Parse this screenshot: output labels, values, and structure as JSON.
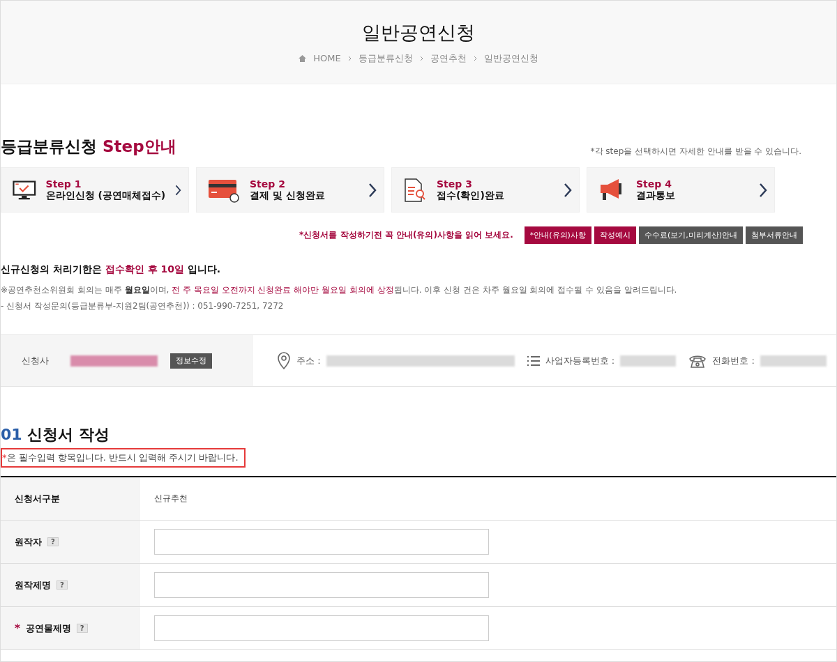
{
  "header": {
    "title": "일반공연신청",
    "breadcrumb": [
      "HOME",
      "등급분류신청",
      "공연추천",
      "일반공연신청"
    ]
  },
  "guide": {
    "title": "등급분류신청",
    "title_accent": "Step안내",
    "hint": "*각 step을 선택하시면 자세한 안내를 받을 수 있습니다."
  },
  "steps": [
    {
      "kind": "monitor",
      "step": "Step 1",
      "label": "온라인신청 (공연매체접수)"
    },
    {
      "kind": "card",
      "step": "Step 2",
      "label": "결제 및 신청완료"
    },
    {
      "kind": "document",
      "step": "Step 3",
      "label": "접수(확인)완료"
    },
    {
      "kind": "megaphone",
      "step": "Step 4",
      "label": "결과통보"
    }
  ],
  "notice_bar": {
    "text": "*신청서를 작성하기전 꼭 안내(유의)사항을 읽어 보세요.",
    "buttons": [
      {
        "label": "*안내(유의)사항",
        "kind": "primary"
      },
      {
        "label": "작성예시",
        "kind": "primary"
      },
      {
        "label": "수수료(보기,미리계산)안내",
        "kind": "dark"
      },
      {
        "label": "첨부서류안내",
        "kind": "dark"
      }
    ]
  },
  "deadline": [
    {
      "text": "신규신청의 처리기한은 ",
      "kind": "plain"
    },
    {
      "text": "접수확인 후 10일",
      "kind": "accent"
    },
    {
      "text": " 입니다.",
      "kind": "plain"
    }
  ],
  "info_lines": [
    [
      {
        "text": "※공연추천소위원회 회의는 매주 ",
        "kind": "plain"
      },
      {
        "text": "월요일",
        "kind": "bold"
      },
      {
        "text": "이며, ",
        "kind": "plain"
      },
      {
        "text": "전 주 목요일 오전까지 신청완료 해야만 월요일 회의에 상정",
        "kind": "accent"
      },
      {
        "text": "됩니다. 이후 신청 건은 차주 월요일 회의에 접수될 수 있음을 알려드립니다.",
        "kind": "plain"
      }
    ],
    [
      {
        "text": "- 신청서 작성문의(등급분류부-지원2팀(공연추천)) : 051-990-7251, 7272",
        "kind": "plain"
      }
    ]
  ],
  "applicant": {
    "label": "신청사",
    "edit_button": "정보수정",
    "fields": [
      {
        "kind": "pin",
        "label": "주소 :"
      },
      {
        "kind": "list",
        "label": "사업자등록번호 :"
      },
      {
        "kind": "phone",
        "label": "전화번호 :"
      }
    ]
  },
  "form": {
    "number": "01",
    "title": "신청서 작성",
    "required_mark": "*",
    "note": "은 필수입력 항목입니다. 반드시 입력해 주시기 바랍니다.",
    "rows": [
      {
        "kind": "text",
        "label": "신청서구분",
        "value": "신규추천",
        "required": false
      },
      {
        "kind": "input",
        "label": "원작자",
        "help": "?",
        "required": false
      },
      {
        "kind": "input",
        "label": "원작제명",
        "help": "?",
        "required": false
      },
      {
        "kind": "input",
        "label": "공연물제명",
        "help": "?",
        "required": true
      }
    ]
  }
}
